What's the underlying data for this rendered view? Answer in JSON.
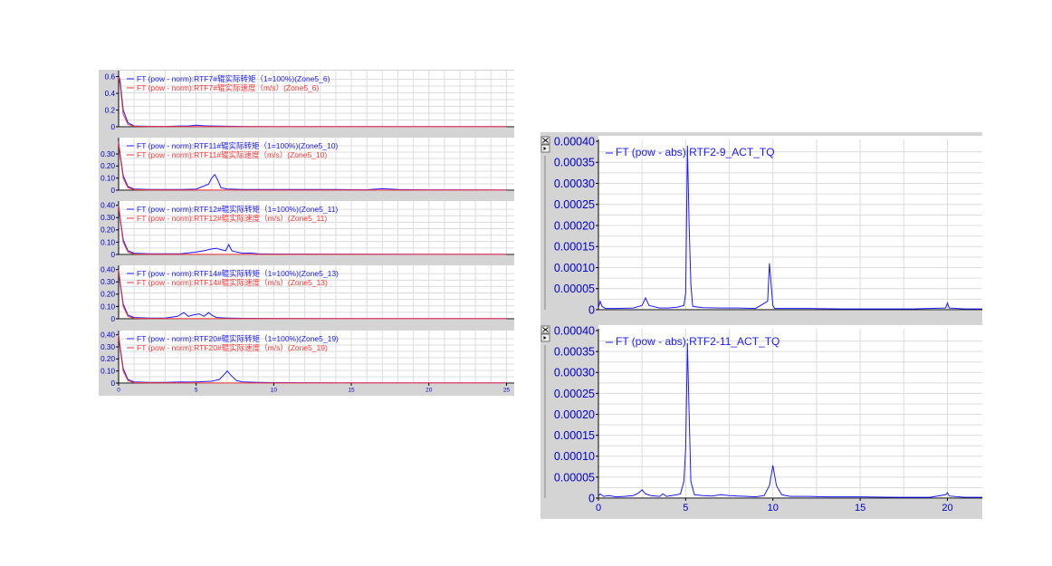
{
  "chart_data": [
    {
      "type": "line",
      "panel": "left",
      "ylim": [
        0,
        0.65
      ],
      "yticks": [
        "0",
        "0.2",
        "0.4",
        "0.6"
      ],
      "xlim": [
        0,
        25.5
      ],
      "legend": [
        "FT (pow - norm):RTF7#辊实际转矩（1=100%)(Zone5_6)",
        "FT (pow - norm):RTF7#辊实际速度（m/s）(Zone5_6)"
      ],
      "series": [
        {
          "name": "FT (pow - norm):RTF7#辊实际转矩（1=100%)(Zone5_6)",
          "color": "#1a1aff",
          "x": [
            0,
            0.1,
            0.3,
            0.6,
            1,
            2,
            3,
            4,
            4.5,
            5,
            5.5,
            6,
            7,
            8,
            10,
            15,
            20,
            25
          ],
          "y": [
            0.62,
            0.55,
            0.2,
            0.05,
            0.01,
            0.005,
            0.004,
            0.01,
            0.01,
            0.02,
            0.012,
            0.01,
            0.006,
            0.004,
            0.003,
            0.002,
            0.002,
            0.002
          ]
        },
        {
          "name": "FT (pow - norm):RTF7#辊实际速度（m/s）(Zone5_6)",
          "color": "#ff3333",
          "x": [
            0,
            0.1,
            0.3,
            0.6,
            1,
            2,
            5,
            10,
            15,
            20,
            25
          ],
          "y": [
            0.6,
            0.5,
            0.15,
            0.03,
            0.005,
            0.002,
            0.002,
            0.001,
            0.001,
            0.001,
            0.001
          ]
        }
      ]
    },
    {
      "type": "line",
      "panel": "left",
      "ylim": [
        0,
        0.42
      ],
      "yticks": [
        "0",
        "0.10",
        "0.20",
        "0.30"
      ],
      "xlim": [
        0,
        25.5
      ],
      "legend": [
        "FT (pow - norm):RTF11#辊实际转矩（1=100%)(Zone5_10)",
        "FT (pow - norm):RTF11#辊实际速度（m/s）(Zone5_10)"
      ],
      "series": [
        {
          "name": "FT (pow - norm):RTF11#辊实际转矩（1=100%)(Zone5_10)",
          "color": "#1a1aff",
          "x": [
            0,
            0.1,
            0.3,
            0.6,
            1,
            2,
            4,
            5,
            5.8,
            6.0,
            6.2,
            6.4,
            6.6,
            7,
            8,
            10,
            12,
            14,
            16,
            17,
            18,
            19,
            20,
            25
          ],
          "y": [
            0.4,
            0.3,
            0.12,
            0.03,
            0.01,
            0.005,
            0.005,
            0.008,
            0.05,
            0.1,
            0.13,
            0.08,
            0.02,
            0.01,
            0.006,
            0.006,
            0.005,
            0.005,
            0.004,
            0.012,
            0.006,
            0.004,
            0.003,
            0.002
          ]
        },
        {
          "name": "FT (pow - norm):RTF11#辊实际速度（m/s）(Zone5_10)",
          "color": "#ff3333",
          "x": [
            0,
            0.1,
            0.3,
            0.6,
            1,
            2,
            10,
            25
          ],
          "y": [
            0.4,
            0.28,
            0.1,
            0.02,
            0.004,
            0.002,
            0.001,
            0.001
          ]
        }
      ]
    },
    {
      "type": "line",
      "panel": "left",
      "ylim": [
        0,
        0.42
      ],
      "yticks": [
        "0",
        "0.10",
        "0.20",
        "0.30",
        "0.40"
      ],
      "xlim": [
        0,
        25.5
      ],
      "legend": [
        "FT (pow - norm):RTF12#辊实际转矩（1=100%)(Zone5_11)",
        "FT (pow - norm):RTF12#辊实际速度（m/s）(Zone5_11)"
      ],
      "series": [
        {
          "name": "FT (pow - norm):RTF12#辊实际转矩（1=100%)(Zone5_11)",
          "color": "#1a1aff",
          "x": [
            0,
            0.1,
            0.3,
            0.6,
            1,
            2,
            3,
            4,
            5,
            5.5,
            6,
            6.3,
            6.6,
            6.9,
            7.1,
            7.3,
            7.6,
            8,
            8.5,
            9,
            10,
            15,
            20,
            25
          ],
          "y": [
            0.4,
            0.3,
            0.12,
            0.03,
            0.01,
            0.005,
            0.005,
            0.006,
            0.02,
            0.03,
            0.045,
            0.05,
            0.04,
            0.03,
            0.08,
            0.03,
            0.02,
            0.01,
            0.012,
            0.005,
            0.004,
            0.003,
            0.002,
            0.002
          ]
        },
        {
          "name": "FT (pow - norm):RTF12#辊实际速度（m/s）(Zone5_11)",
          "color": "#ff3333",
          "x": [
            0,
            0.1,
            0.3,
            0.6,
            1,
            2,
            10,
            25
          ],
          "y": [
            0.4,
            0.28,
            0.1,
            0.02,
            0.004,
            0.002,
            0.001,
            0.001
          ]
        }
      ]
    },
    {
      "type": "line",
      "panel": "left",
      "ylim": [
        0,
        0.42
      ],
      "yticks": [
        "0",
        "0.10",
        "0.20",
        "0.30",
        "0.40"
      ],
      "xlim": [
        0,
        25.5
      ],
      "legend": [
        "FT (pow - norm):RTF14#辊实际转矩（1=100%)(Zone5_13)",
        "FT (pow - norm):RTF14#辊实际速度（m/s）(Zone5_13)"
      ],
      "series": [
        {
          "name": "FT (pow - norm):RTF14#辊实际转矩（1=100%)(Zone5_13)",
          "color": "#1a1aff",
          "x": [
            0,
            0.1,
            0.3,
            0.6,
            1,
            2,
            3,
            3.8,
            4.2,
            4.5,
            4.8,
            5.2,
            5.5,
            5.8,
            6.0,
            6.3,
            7,
            8,
            10,
            15,
            20,
            25
          ],
          "y": [
            0.4,
            0.3,
            0.12,
            0.03,
            0.01,
            0.005,
            0.005,
            0.02,
            0.05,
            0.02,
            0.03,
            0.04,
            0.02,
            0.05,
            0.03,
            0.01,
            0.006,
            0.004,
            0.003,
            0.002,
            0.002,
            0.002
          ]
        },
        {
          "name": "FT (pow - norm):RTF14#辊实际速度（m/s）(Zone5_13)",
          "color": "#ff3333",
          "x": [
            0,
            0.1,
            0.3,
            0.6,
            1,
            2,
            10,
            25
          ],
          "y": [
            0.4,
            0.28,
            0.1,
            0.02,
            0.004,
            0.002,
            0.001,
            0.001
          ]
        }
      ]
    },
    {
      "type": "line",
      "panel": "left",
      "ylim": [
        0,
        0.42
      ],
      "yticks": [
        "0",
        "0.10",
        "0.20",
        "0.30",
        "0.40"
      ],
      "xlim": [
        0,
        25.5
      ],
      "xticks": [
        "0",
        "5",
        "10",
        "15",
        "20",
        "25"
      ],
      "legend": [
        "FT (pow - norm):RTF20#辊实际转矩（1=100%)(Zone5_19)",
        "FT (pow - norm):RTF20#辊实际速度（m/s）(Zone5_19)"
      ],
      "series": [
        {
          "name": "FT (pow - norm):RTF20#辊实际转矩（1=100%)(Zone5_19)",
          "color": "#1a1aff",
          "x": [
            0,
            0.1,
            0.3,
            0.6,
            1,
            2,
            3,
            4,
            4.5,
            5,
            6,
            6.5,
            6.8,
            7.0,
            7.2,
            7.6,
            8,
            9,
            10,
            12,
            15,
            20,
            25
          ],
          "y": [
            0.4,
            0.3,
            0.12,
            0.03,
            0.01,
            0.005,
            0.005,
            0.01,
            0.008,
            0.01,
            0.015,
            0.03,
            0.07,
            0.1,
            0.07,
            0.02,
            0.01,
            0.006,
            0.004,
            0.003,
            0.002,
            0.002,
            0.002
          ]
        },
        {
          "name": "FT (pow - norm):RTF20#辊实际速度（m/s）(Zone5_19)",
          "color": "#ff3333",
          "x": [
            0,
            0.1,
            0.3,
            0.6,
            1,
            2,
            10,
            25
          ],
          "y": [
            0.4,
            0.28,
            0.1,
            0.02,
            0.004,
            0.002,
            0.001,
            0.001
          ]
        }
      ]
    },
    {
      "type": "line",
      "panel": "right",
      "ylim": [
        0,
        0.0004
      ],
      "yticks": [
        "0",
        "0.00005",
        "0.00010",
        "0.00015",
        "0.00020",
        "0.00025",
        "0.00030",
        "0.00035",
        "0.00040"
      ],
      "xlim": [
        0,
        22
      ],
      "legend": [
        "FT (pow - abs):RTF2-9_ACT_TQ"
      ],
      "series": [
        {
          "name": "FT (pow - abs):RTF2-9_ACT_TQ",
          "color": "#1a1aff",
          "x": [
            0,
            0.1,
            0.2,
            0.4,
            1,
            2,
            2.5,
            2.7,
            2.9,
            3.5,
            4,
            4.5,
            4.9,
            5.0,
            5.1,
            5.2,
            5.3,
            5.4,
            6,
            7,
            8,
            9,
            9.7,
            9.8,
            9.9,
            10.0,
            10.1,
            10.5,
            12,
            14,
            16,
            18,
            19.9,
            20.0,
            20.1,
            21,
            22
          ],
          "y": [
            5e-06,
            2e-05,
            8e-06,
            3e-06,
            3e-06,
            4e-06,
            1e-05,
            2.8e-05,
            1e-05,
            4e-06,
            4e-06,
            6e-06,
            1e-05,
            4e-05,
            0.00039,
            0.0002,
            6e-05,
            8e-06,
            5e-06,
            4e-06,
            4e-06,
            3e-06,
            2e-05,
            0.00011,
            6e-05,
            1e-05,
            3e-06,
            3e-06,
            3e-06,
            2e-06,
            2e-06,
            2e-06,
            4e-06,
            1.6e-05,
            4e-06,
            2e-06,
            2e-06
          ]
        }
      ]
    },
    {
      "type": "line",
      "panel": "right",
      "ylim": [
        0,
        0.0004
      ],
      "yticks": [
        "0",
        "0.00005",
        "0.00010",
        "0.00015",
        "0.00020",
        "0.00025",
        "0.00030",
        "0.00035",
        "0.00040"
      ],
      "xlim": [
        0,
        22
      ],
      "xticks": [
        "0",
        "5",
        "10",
        "15",
        "20"
      ],
      "legend": [
        "FT (pow - abs):RTF2-11_ACT_TQ"
      ],
      "series": [
        {
          "name": "FT (pow - abs):RTF2-11_ACT_TQ",
          "color": "#1a1aff",
          "x": [
            0,
            0.1,
            0.3,
            0.6,
            1,
            1.5,
            2,
            2.3,
            2.5,
            2.7,
            3,
            3.5,
            3.7,
            3.9,
            4.2,
            4.5,
            4.7,
            4.9,
            5.0,
            5.1,
            5.2,
            5.3,
            5.5,
            6,
            6.5,
            7,
            7.5,
            8,
            8.5,
            9,
            9.5,
            9.8,
            10.0,
            10.2,
            10.5,
            11,
            12,
            13,
            15,
            17,
            19,
            19.9,
            20.0,
            20.1,
            21,
            22
          ],
          "y": [
            5e-06,
            1e-05,
            4e-06,
            6e-06,
            3e-06,
            4e-06,
            6e-06,
            1.2e-05,
            2e-05,
            1e-05,
            6e-06,
            4e-06,
            1e-05,
            4e-06,
            6e-06,
            8e-06,
            1e-05,
            4e-05,
            0.00012,
            0.00037,
            0.0002,
            4e-05,
            8e-06,
            6e-06,
            5e-06,
            8e-06,
            6e-06,
            5e-06,
            4e-06,
            3e-06,
            6e-06,
            3e-05,
            7.8e-05,
            3e-05,
            8e-06,
            4e-06,
            4e-06,
            3e-06,
            3e-06,
            2e-06,
            2e-06,
            8e-06,
            1.3e-05,
            5e-06,
            2e-06,
            2e-06
          ]
        }
      ]
    }
  ]
}
